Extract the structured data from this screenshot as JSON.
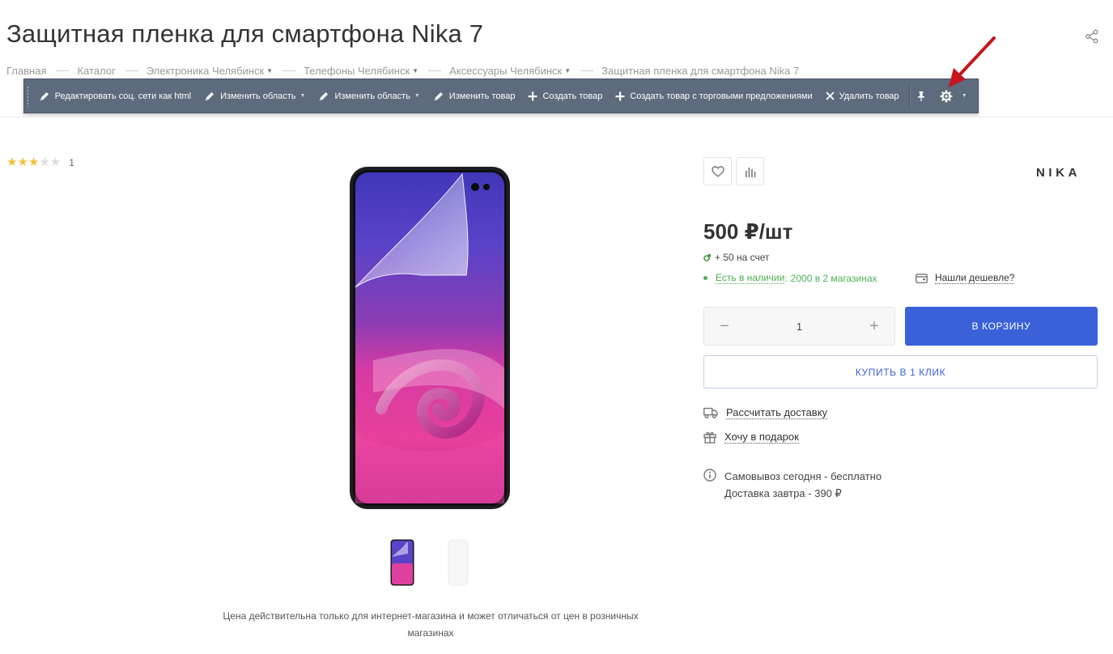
{
  "page": {
    "title": "Защитная пленка для смартфона Nika 7"
  },
  "breadcrumb": [
    {
      "label": "Главная"
    },
    {
      "label": "Каталог"
    },
    {
      "label": "Электроника Челябинск"
    },
    {
      "label": "Телефоны Челябинск"
    },
    {
      "label": "Аксессуары Челябинск"
    },
    {
      "label": "Защитная пленка для смартфона Nika 7"
    }
  ],
  "toolbar": {
    "edit_social": "Редактировать соц. сети как html",
    "edit_area_1": "Изменить область",
    "edit_area_2": "Изменить область",
    "edit_product": "Изменить товар",
    "create_product": "Создать товар",
    "create_product_offers": "Создать товар с торговыми предложениями",
    "delete_product": "Удалить товар"
  },
  "rating": {
    "value": 3,
    "max": 5,
    "count": "1"
  },
  "brand": {
    "logo_text": "NIKA"
  },
  "price": {
    "value": "500 ₽/шт",
    "bonus": "+ 50 на счет"
  },
  "stock": {
    "label": "Есть в наличии",
    "colon": ":",
    "count": "2000 в 2 магазинах"
  },
  "cheaper": {
    "label": "Нашли дешевле?"
  },
  "quantity": {
    "minus": "−",
    "value": "1",
    "plus": "+"
  },
  "actions": {
    "cart": "В КОРЗИНУ",
    "one_click": "КУПИТЬ В 1 КЛИК",
    "delivery": "Рассчитать доставку",
    "gift": "Хочу в подарок"
  },
  "pickup": {
    "line1": "Самовывоз сегодня - бесплатно",
    "line2": "Доставка завтра - 390 ₽"
  },
  "notice": "Цена действительна только для интернет-магазина и может отличаться от цен в розничных магазинах",
  "colors": {
    "accent": "#3a61d8",
    "toolbar_bg": "#5d6b7c",
    "stock_green": "#4caf50",
    "star": "#f0c23b",
    "arrow": "#c8141c"
  },
  "icons": {
    "share": "share-icon",
    "pencil": "pencil-icon",
    "plus": "plus-icon",
    "close": "close-icon",
    "pin": "pin-icon",
    "gear": "gear-icon",
    "heart": "heart-icon",
    "compare": "compare-icon",
    "wallet": "wallet-icon",
    "truck": "truck-icon",
    "gift": "gift-icon",
    "info": "info-icon"
  }
}
